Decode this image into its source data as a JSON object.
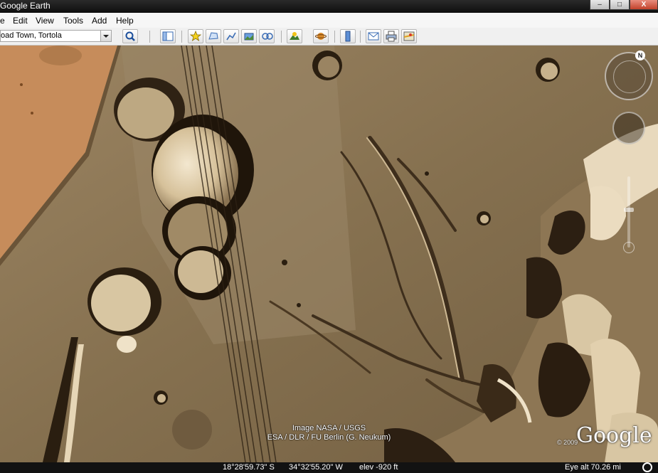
{
  "window": {
    "title": "Google Earth",
    "controls": [
      "–",
      "□",
      "X"
    ]
  },
  "menu": [
    "e",
    "Edit",
    "View",
    "Tools",
    "Add",
    "Help"
  ],
  "search": {
    "value": "oad Town, Tortola"
  },
  "toolbar": {
    "icons": [
      "search-icon",
      "sidebar-toggle-icon",
      "placemark-icon",
      "polygon-icon",
      "path-icon",
      "image-overlay-icon",
      "record-tour-icon",
      "historical-imagery-icon",
      "sunlight-icon",
      "planets-icon",
      "ruler-icon",
      "email-icon",
      "print-icon",
      "view-in-maps-icon"
    ]
  },
  "map": {
    "attribution_line1": "Image NASA / USGS",
    "attribution_line2": "ESA / DLR / FU Berlin (G. Neukum)",
    "logo": "Google",
    "copyright": "© 2009",
    "compass_letter": "N"
  },
  "status": {
    "lat": "18°28'59.73\" S",
    "lon": "34°32'55.20\" W",
    "elev": "elev  -920 ft",
    "eye_alt": "Eye alt   70.26 mi"
  },
  "colors": {
    "terrain_base": "#8a7456",
    "terrain_dark": "#3a2c1c",
    "terrain_light": "#e6d6bb",
    "mars_orange": "#c48a5a"
  }
}
